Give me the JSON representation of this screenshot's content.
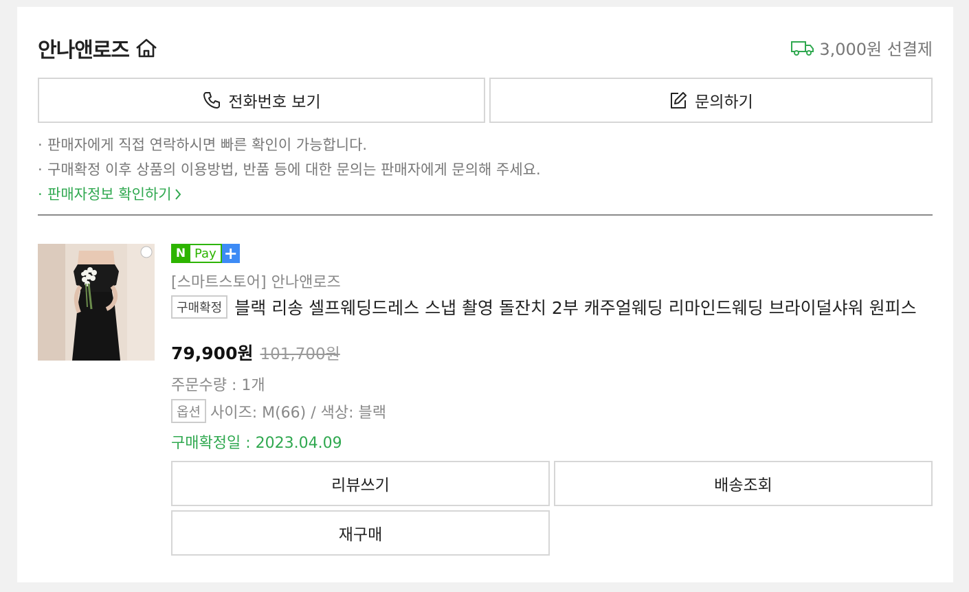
{
  "store": {
    "name": "안나앤로즈",
    "home_icon": "home-icon",
    "shipping_icon": "truck-icon",
    "shipping_text": "3,000원 선결제"
  },
  "contact": {
    "phone_label": "전화번호 보기",
    "phone_icon": "phone-icon",
    "inquiry_label": "문의하기",
    "inquiry_icon": "edit-icon"
  },
  "notices": [
    "판매자에게 직접 연락하시면 빠른 확인이 가능합니다.",
    "구매확정 이후 상품의 이용방법, 반품 등에 대한 문의는 판매자에게 문의해 주세요."
  ],
  "seller_info_link": "판매자정보 확인하기",
  "product": {
    "npay_n": "N",
    "npay_label": "Pay",
    "npay_plus": "+",
    "store_line": "[스마트스토어] 안나앤로즈",
    "status_badge": "구매확정",
    "title": "블랙 리송 셀프웨딩드레스 스냅 촬영 돌잔치 2부 캐주얼웨딩 리마인드웨딩 브라이덜샤워 원피스",
    "price": "79,900원",
    "original_price": "101,700원",
    "quantity": "주문수량 : 1개",
    "option_badge": "옵션",
    "option_text": "사이즈: M(66) / 색상: 블랙",
    "confirm_date": "구매확정일 : 2023.04.09"
  },
  "actions": {
    "review": "리뷰쓰기",
    "tracking": "배송조회",
    "rebuy": "재구매"
  },
  "colors": {
    "accent_green": "#2fa84f",
    "npay_green": "#2db400",
    "npay_blue": "#3d8bf5"
  }
}
